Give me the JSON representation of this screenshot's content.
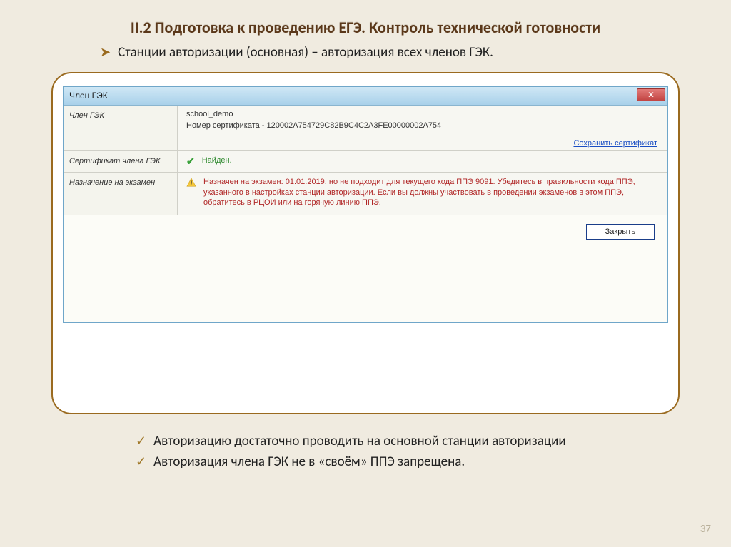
{
  "slide": {
    "bg_title": "II.2 Подготовка к проведению ЕГЭ. Контроль технической готовности",
    "title": "II.2 Подготовка к проведению ЕГЭ. Контроль технической готовности",
    "subtitle": "Станции авторизации (основная) – авторизация всех членов ГЭК.",
    "notes": [
      "Авторизацию достаточно проводить на основной станции авторизации",
      "Авторизация члена ГЭК не в «своём» ППЭ запрещена."
    ],
    "page": "37"
  },
  "dialog": {
    "window_title": "Член ГЭК",
    "close_x": "✕",
    "rows": {
      "member": {
        "label": "Член ГЭК",
        "school": "school_demo",
        "cert_label": "Номер сертификата - 120002A754729C82B9C4C2A3FE00000002A754",
        "save_link": "Сохранить сертификат"
      },
      "cert": {
        "label": "Сертификат члена ГЭК",
        "status": "Найден."
      },
      "assign": {
        "label": "Назначение на экзамен",
        "warning": "Назначен на экзамен: 01.01.2019, но не подходит для текущего кода ППЭ 9091. Убедитесь в правильности кода ППЭ, указанного в настройках станции авторизации. Если вы должны участвовать в проведении экзаменов в этом ППЭ, обратитесь в РЦОИ или на горячую линию ППЭ."
      }
    },
    "close_button": "Закрыть"
  }
}
